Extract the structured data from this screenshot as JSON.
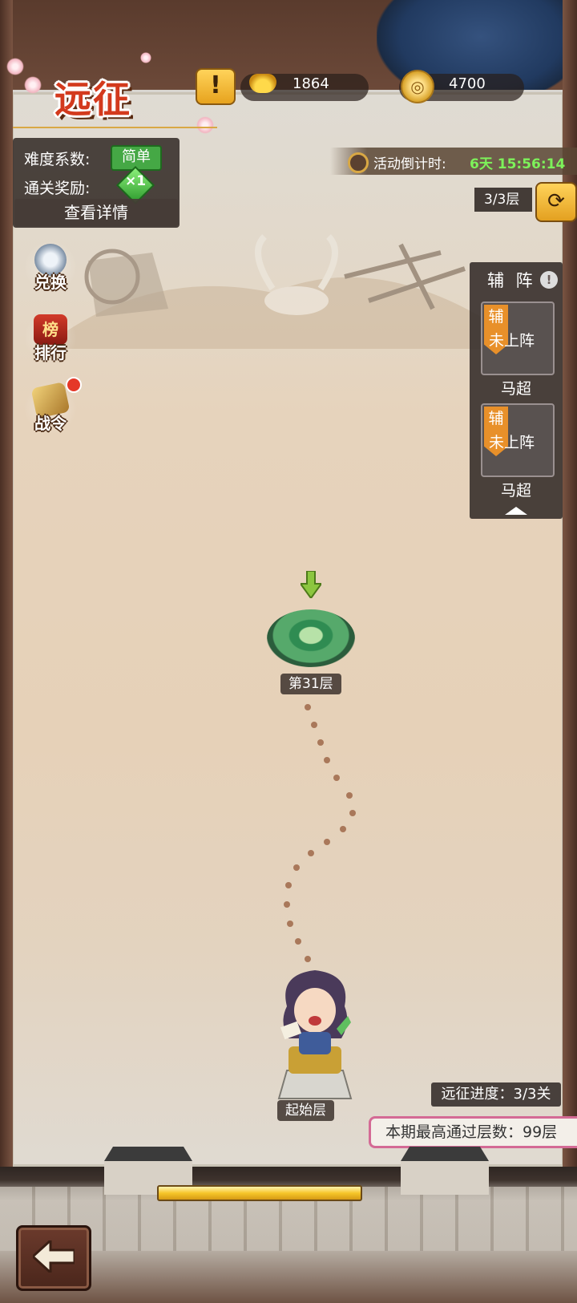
{
  "header": {
    "title": "远征",
    "warn_icon": "exclamation-icon",
    "gold_ingot": "1864",
    "coins": "4700"
  },
  "info_panel": {
    "difficulty_label": "难度系数:",
    "difficulty_value": "简单",
    "reward_label": "通关奖励:",
    "reward_value": "×1",
    "detail_button": "查看详情"
  },
  "event": {
    "countdown_label": "活动倒计时:",
    "countdown_value": "6天 15:56:14"
  },
  "floor_counter": "3/3层",
  "side_menu": [
    {
      "label": "兑换",
      "icon": "coin-exchange-icon"
    },
    {
      "label": "排行",
      "icon": "ranking-icon",
      "badge": "榜"
    },
    {
      "label": "战令",
      "icon": "battle-pass-icon"
    }
  ],
  "support": {
    "title": "辅 阵",
    "slots": [
      {
        "tag": "辅",
        "status": "未上阵",
        "name": "马超"
      },
      {
        "tag": "辅",
        "status": "未上阵",
        "name": "马超"
      }
    ]
  },
  "map": {
    "stage_label": "第31层",
    "start_label": "起始层"
  },
  "footer": {
    "progress_text": "远征进度：3/3关",
    "best_text": "本期最高通过层数：99层",
    "progress_fill": 0.52
  },
  "colors": {
    "title_red": "#d33a1d",
    "countdown_green": "#7df25a",
    "easy_green": "#45a845",
    "slot_orange": "#e8902a"
  }
}
